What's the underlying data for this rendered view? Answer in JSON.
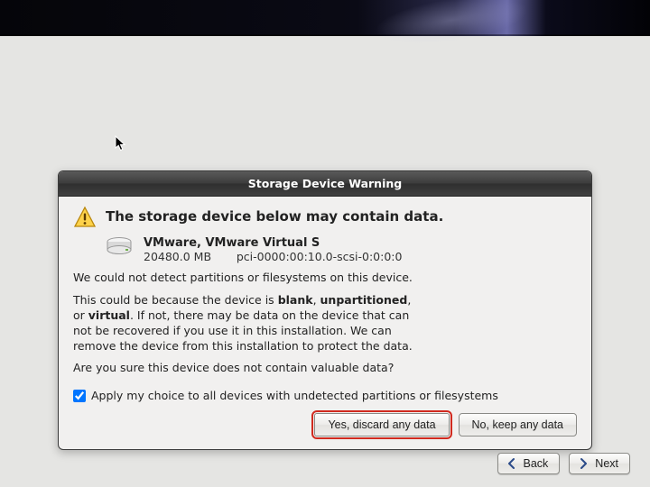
{
  "dialog": {
    "title": "Storage Device Warning",
    "headline": "The storage device below may contain data.",
    "device": {
      "name": "VMware, VMware Virtual S",
      "size": "20480.0 MB",
      "path": "pci-0000:00:10.0-scsi-0:0:0:0"
    },
    "line1": "We could not detect partitions or filesystems on this device.",
    "para_prefix": "This could be because the device is ",
    "blank_word": "blank",
    "unpart_word": "unpartitioned",
    "virtual_word": "virtual",
    "para_mid": ". If not, there may be data on the device that can\nnot be recovered if you use it in this installation. We can\nremove the device from this installation to protect the data.",
    "confirm_q": "Are you sure this device does not contain valuable data?",
    "apply_all": "Apply my choice to all devices with undetected partitions or filesystems",
    "yes_btn": "Yes, discard any data",
    "no_btn": "No, keep any data"
  },
  "nav": {
    "back": "Back",
    "next": "Next"
  }
}
